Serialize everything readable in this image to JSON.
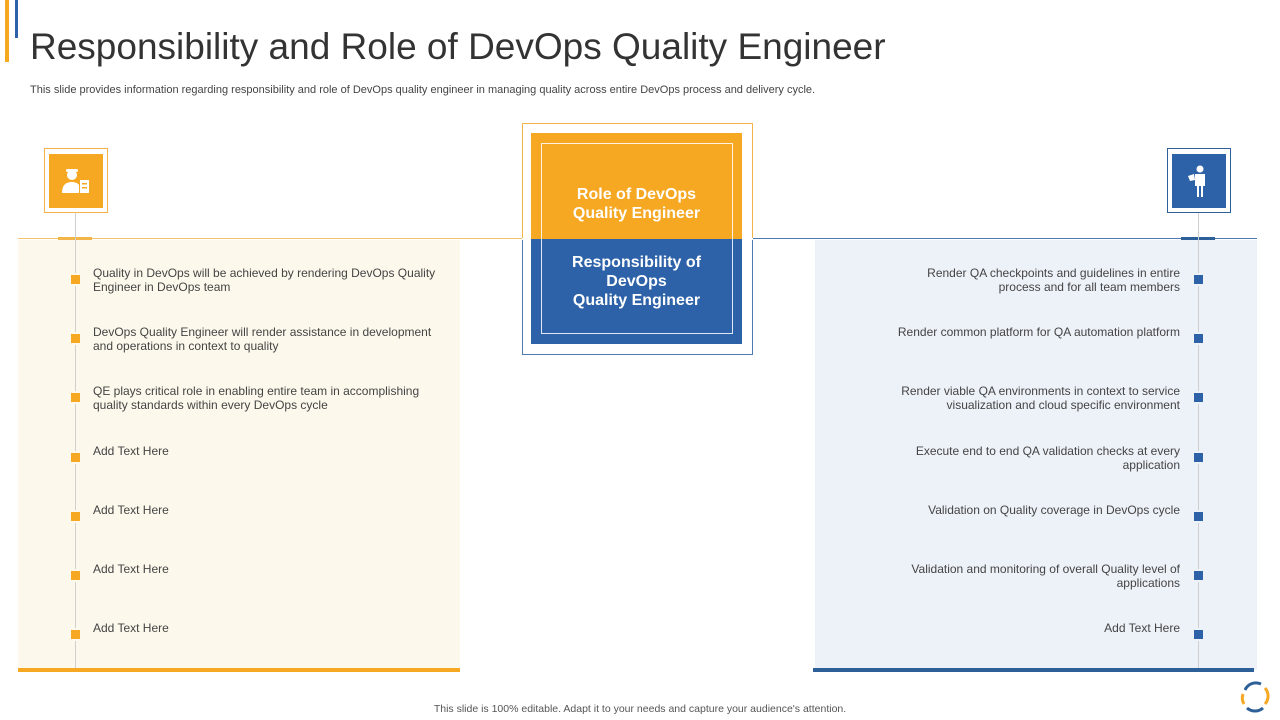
{
  "title": "Responsibility and Role of DevOps Quality Engineer",
  "subtitle": "This slide provides information regarding responsibility and role of DevOps quality engineer in managing quality across entire DevOps process and delivery cycle.",
  "center": {
    "role_label": "Role of DevOps Quality Engineer",
    "responsibility_label_lines": [
      "Responsibility of",
      "DevOps",
      "Quality Engineer"
    ]
  },
  "left": {
    "icon": "engineer-with-clipboard-icon",
    "items": [
      "Quality in DevOps will be achieved by rendering DevOps Quality Engineer in DevOps team",
      "DevOps Quality Engineer will render assistance in development and operations in context to quality",
      "QE plays critical role in enabling entire team in accomplishing quality standards within every DevOps cycle",
      "Add Text Here",
      "Add Text Here",
      "Add Text Here",
      "Add Text Here"
    ]
  },
  "right": {
    "icon": "engineer-icon",
    "items": [
      "Render QA checkpoints and guidelines in entire process and for all team members",
      "Render common platform for QA automation platform",
      "Render viable QA environments in context to service visualization and cloud specific environment",
      "Execute end to end QA validation checks at every application",
      "Validation on Quality coverage in DevOps cycle",
      "Validation and monitoring of overall Quality level of applications",
      "Add Text Here"
    ]
  },
  "footer": "This slide is 100% editable. Adapt it to your needs and capture your audience's attention.",
  "colors": {
    "orange": "#f6a823",
    "blue": "#2d62a9"
  }
}
